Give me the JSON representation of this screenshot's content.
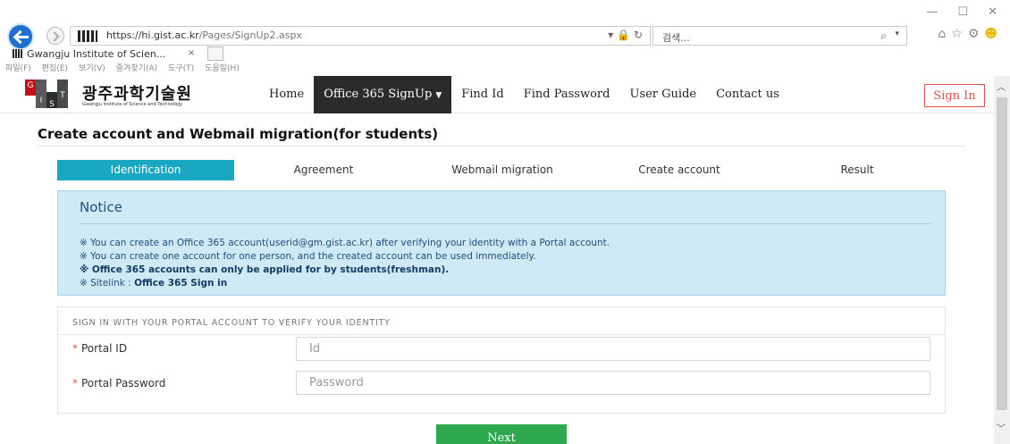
{
  "browser": {
    "url_host": "https://hi.gist.ac.kr",
    "url_path": "/Pages/SignUp2.aspx",
    "search_placeholder": "검색...",
    "tab_title": "Gwangju Institute of Scien...",
    "tab_close": "×",
    "menu": [
      "파일(F)",
      "편집(E)",
      "보기(V)",
      "즐겨찾기(A)",
      "도구(T)",
      "도움말(H)"
    ],
    "window_minimize": "—",
    "window_maximize": "☐",
    "window_close": "✕"
  },
  "logo": {
    "letters": [
      "G",
      "I",
      "S",
      "T"
    ],
    "korean": "광주과학기술원",
    "english": "Gwangju Institute of Science and Technology"
  },
  "nav": {
    "home": "Home",
    "office365": "Office 365 SignUp",
    "find_id": "Find Id",
    "find_password": "Find Password",
    "user_guide": "User Guide",
    "contact_us": "Contact us",
    "sign_in": "Sign In"
  },
  "page": {
    "title": "Create account and Webmail migration(for students)"
  },
  "steps": [
    "Identification",
    "Agreement",
    "Webmail migration",
    "Create account",
    "Result"
  ],
  "notice": {
    "title": "Notice",
    "line1": "※ You can create an Office 365 account(userid@gm.gist.ac.kr) after verifying your identity with a Portal account.",
    "line2": "※ You can create one account for one person, and the created account can be used immediately.",
    "line3": "※ Office 365 accounts can only be applied for by students(freshman).",
    "line4_prefix": "※ Sitelink : ",
    "line4_link": "Office 365 Sign in"
  },
  "form": {
    "heading": "SIGN IN WITH YOUR PORTAL ACCOUNT TO VERIFY YOUR IDENTITY",
    "required_mark": "*",
    "portal_id_label": "Portal ID",
    "portal_id_placeholder": "Id",
    "portal_password_label": "Portal Password",
    "portal_password_placeholder": "Password",
    "next": "Next"
  },
  "colors": {
    "accent_step": "#1aa7c2",
    "notice_bg": "#cfe9f7",
    "next_button": "#2ea84f",
    "sign_in_border": "#d9534f",
    "nav_active_bg": "#2b2b2b"
  }
}
